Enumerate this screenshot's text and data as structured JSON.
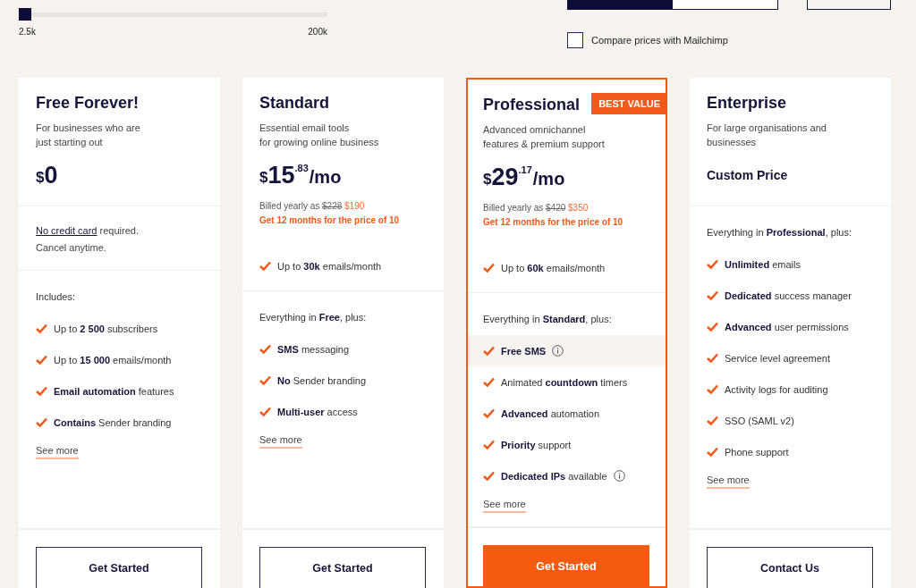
{
  "slider": {
    "level": 0,
    "min_label": "2.5k",
    "max_label": "200k"
  },
  "billing_toggle": [
    {
      "selected": true
    },
    {
      "selected": false
    }
  ],
  "compare": {
    "label": "Compare prices with Mailchimp",
    "checked": false
  },
  "plans": [
    {
      "name": "Free Forever!",
      "featured": false,
      "description": [
        "For businesses who are",
        "just starting out"
      ],
      "price": {
        "kind": "amount",
        "currency": "$",
        "whole": "0"
      },
      "note": {
        "link": "No credit card",
        "text": "required.",
        "line2": "Cancel anytime."
      },
      "features_heading": "Includes:",
      "features": [
        {
          "text": "Up to **2 500** subscribers",
          "info": false,
          "highlighted": false
        },
        {
          "text": "Up to **15 000** emails/month",
          "info": false,
          "highlighted": false
        },
        {
          "text": "**Email automation** features",
          "info": false,
          "highlighted": false
        },
        {
          "text": "**Contains** Sender branding",
          "info": false,
          "highlighted": false
        }
      ],
      "see_more": "See more",
      "button": {
        "label": "Get Started",
        "primary": false
      }
    },
    {
      "name": "Standard",
      "featured": false,
      "description": [
        "Essential email tools",
        "for growing online business"
      ],
      "price": {
        "kind": "amount",
        "currency": "$",
        "whole": "15",
        "cents": ".83",
        "period": "/mo"
      },
      "billing": {
        "prefix": "Billed yearly as",
        "old": "$228",
        "new": "$190",
        "promo": "Get 12 months for the price of 10"
      },
      "highlight_feature": "Up to **30k** emails/month",
      "features_heading": "Everything in **Free**, plus:",
      "features": [
        {
          "text": "**SMS** messaging",
          "info": false,
          "highlighted": false
        },
        {
          "text": "**No** Sender branding",
          "info": false,
          "highlighted": false
        },
        {
          "text": "**Multi-user** access",
          "info": false,
          "highlighted": false
        }
      ],
      "see_more": "See more",
      "button": {
        "label": "Get Started",
        "primary": false
      }
    },
    {
      "name": "Professional",
      "featured": true,
      "badge": "BEST VALUE",
      "description": [
        "Advanced omnichannel",
        "features & premium support"
      ],
      "price": {
        "kind": "amount",
        "currency": "$",
        "whole": "29",
        "cents": ".17",
        "period": "/mo"
      },
      "billing": {
        "prefix": "Billed yearly as",
        "old": "$420",
        "new": "$350",
        "promo": "Get 12 months for the price of 10"
      },
      "highlight_feature": "Up to **60k** emails/month",
      "features_heading": "Everything in **Standard**, plus:",
      "features": [
        {
          "text": "**Free SMS**",
          "info": true,
          "highlighted": true
        },
        {
          "text": "Animated **countdown** timers",
          "info": false,
          "highlighted": false
        },
        {
          "text": "**Advanced** automation",
          "info": false,
          "highlighted": false
        },
        {
          "text": "**Priority** support",
          "info": false,
          "highlighted": false
        },
        {
          "text": "**Dedicated IPs** available",
          "info": true,
          "highlighted": false
        }
      ],
      "see_more": "See more",
      "button": {
        "label": "Get Started",
        "primary": true
      }
    },
    {
      "name": "Enterprise",
      "featured": false,
      "description": [
        "For large organisations and",
        "businesses"
      ],
      "price": {
        "kind": "custom",
        "text": "Custom Price"
      },
      "features_heading": "Everything in **Professional**, plus:",
      "features": [
        {
          "text": "**Unlimited** emails",
          "info": false,
          "highlighted": false
        },
        {
          "text": "**Dedicated** success manager",
          "info": false,
          "highlighted": false
        },
        {
          "text": "**Advanced** user permissions",
          "info": false,
          "highlighted": false
        },
        {
          "text": "Service level agreement",
          "info": false,
          "highlighted": false
        },
        {
          "text": "Activity logs for auditing",
          "info": false,
          "highlighted": false
        },
        {
          "text": "SSO (SAML v2)",
          "info": false,
          "highlighted": false
        },
        {
          "text": "Phone support",
          "info": false,
          "highlighted": false
        }
      ],
      "see_more": "See more",
      "button": {
        "label": "Contact Us",
        "primary": false
      }
    }
  ]
}
